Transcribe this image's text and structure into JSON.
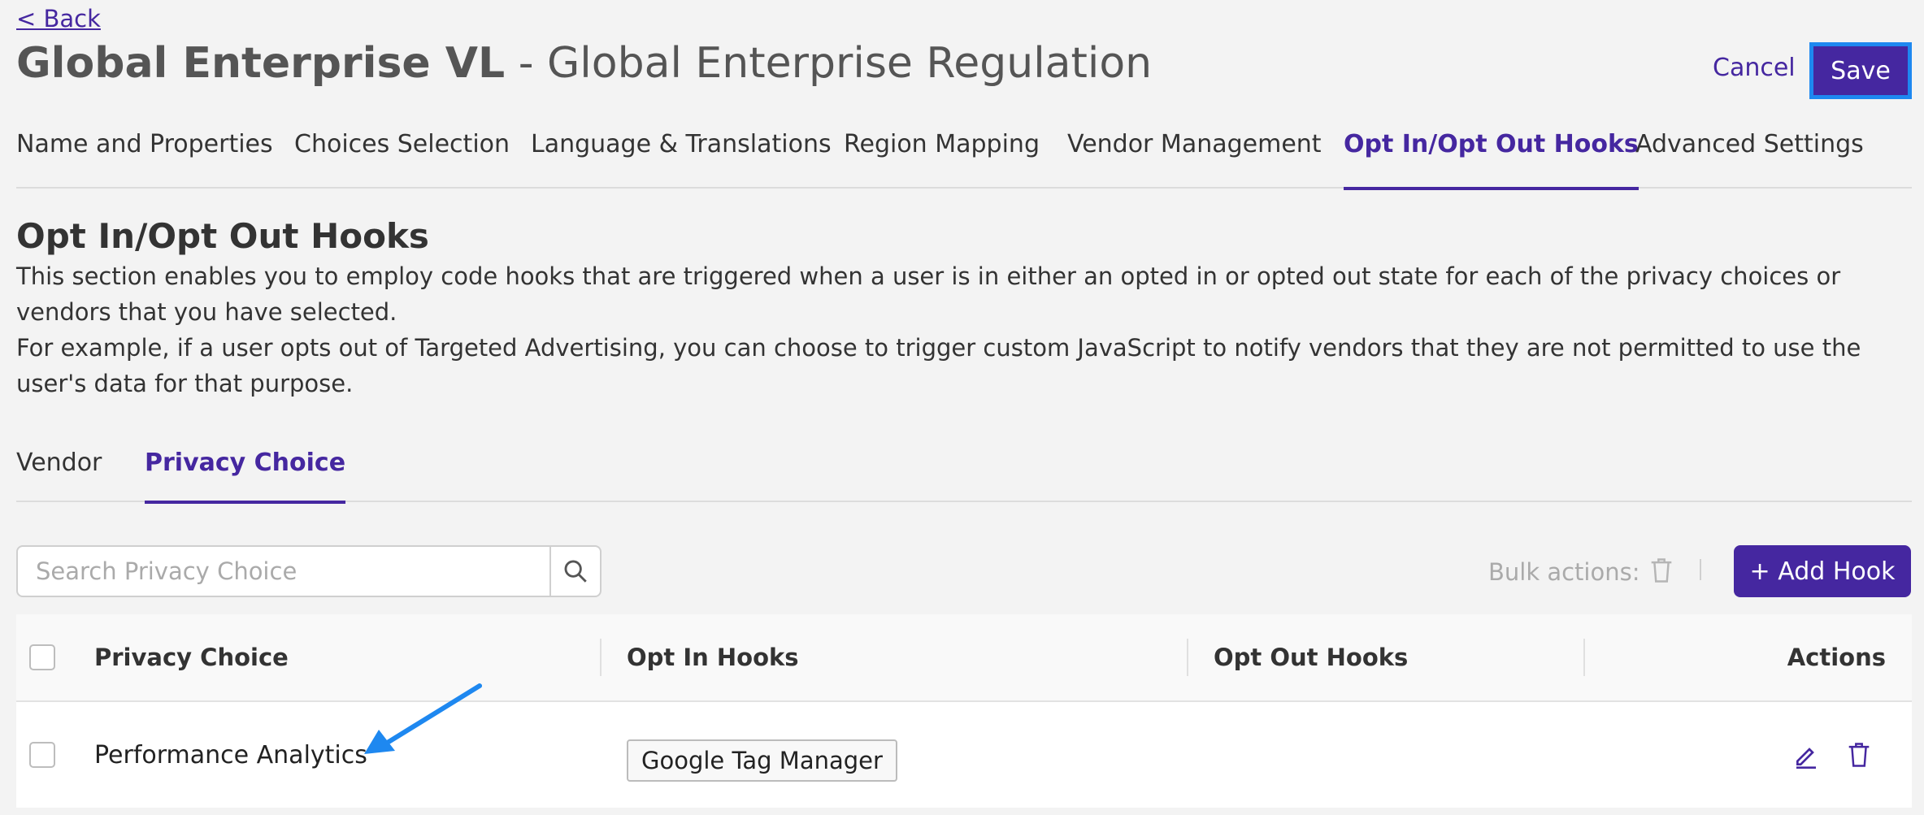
{
  "header": {
    "back_label": "< Back",
    "title_bold": "Global Enterprise VL",
    "title_rest": " - Global Enterprise Regulation",
    "cancel_label": "Cancel",
    "save_label": "Save"
  },
  "tabs": [
    {
      "label": "Name and Properties",
      "active": false
    },
    {
      "label": "Choices Selection",
      "active": false
    },
    {
      "label": "Language & Translations",
      "active": false
    },
    {
      "label": "Region Mapping",
      "active": false
    },
    {
      "label": "Vendor Management",
      "active": false
    },
    {
      "label": "Opt In/Opt Out Hooks",
      "active": true
    },
    {
      "label": "Advanced Settings",
      "active": false
    }
  ],
  "section": {
    "title": "Opt In/Opt Out Hooks",
    "paragraph1": "This section enables you to employ code hooks that are triggered when a user is in either an opted in or opted out state for each of the privacy choices or vendors that you have selected.",
    "paragraph2": "For example, if a user opts out of Targeted Advertising, you can choose to trigger custom JavaScript to notify vendors that they are not permitted to use the user's data for that purpose."
  },
  "subtabs": [
    {
      "label": "Vendor",
      "active": false
    },
    {
      "label": "Privacy Choice",
      "active": true
    }
  ],
  "search": {
    "placeholder": "Search Privacy Choice",
    "value": ""
  },
  "toolbar": {
    "bulk_actions_label": "Bulk actions:",
    "add_hook_label": "+ Add Hook"
  },
  "table": {
    "columns": [
      "Privacy Choice",
      "Opt In Hooks",
      "Opt Out Hooks",
      "Actions"
    ],
    "rows": [
      {
        "privacy_choice": "Performance Analytics",
        "opt_in_hooks": [
          "Google Tag Manager"
        ],
        "opt_out_hooks": []
      }
    ]
  },
  "icons": {
    "search": "search-icon",
    "trash": "trash-icon",
    "edit": "pencil-icon",
    "annotation": "arrow-annotation-icon"
  },
  "colors": {
    "accent": "#4527a0",
    "save_focus_border": "#1e88f0",
    "annotation_arrow": "#1e88f0",
    "background": "#f3f3f3"
  }
}
